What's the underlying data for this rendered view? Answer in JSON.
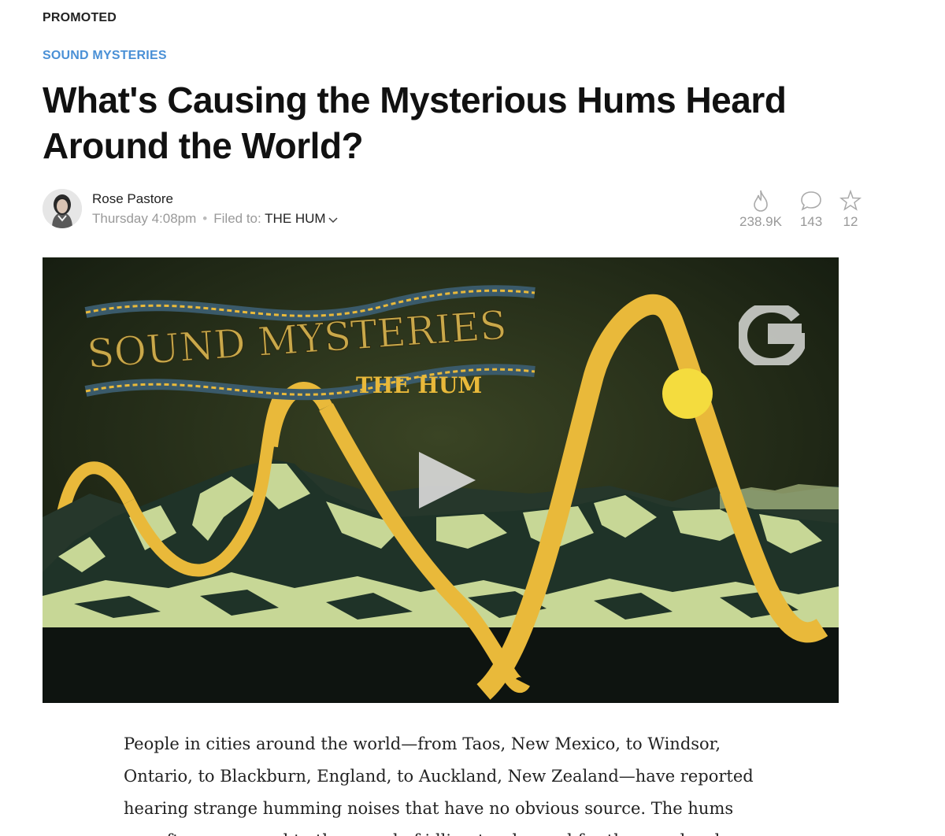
{
  "header": {
    "promoted": "PROMOTED",
    "category": "SOUND MYSTERIES",
    "headline": "What's Causing the Mysterious Hums Heard Around the World?"
  },
  "byline": {
    "author": "Rose Pastore",
    "timestamp": "Thursday 4:08pm",
    "separator": "•",
    "filed_label": "Filed to:",
    "filed_tag": "THE HUM"
  },
  "stats": {
    "views": "238.9K",
    "comments": "143",
    "stars": "12"
  },
  "video": {
    "title_main": "SOUND MYSTERIES",
    "title_sub": "THE HUM",
    "logo": "G",
    "colors": {
      "background": "#1c2415",
      "wave": "#e9b93a",
      "mountain_light": "#c7d796",
      "mountain_dark": "#1f3328",
      "sun": "#f4dc3e"
    }
  },
  "article": {
    "body": "People in cities around the world—from Taos, New Mexico, to Windsor, Ontario, to Blackburn, England, to Auckland, New Zealand—have reported hearing strange humming noises that have no obvious source. The hums are often compared to the sound of idling trucks, and for the people who"
  },
  "icons": {
    "views": "flame-icon",
    "comments": "speech-bubble-icon",
    "stars": "star-icon",
    "chevron": "chevron-down-icon",
    "play": "play-icon"
  }
}
